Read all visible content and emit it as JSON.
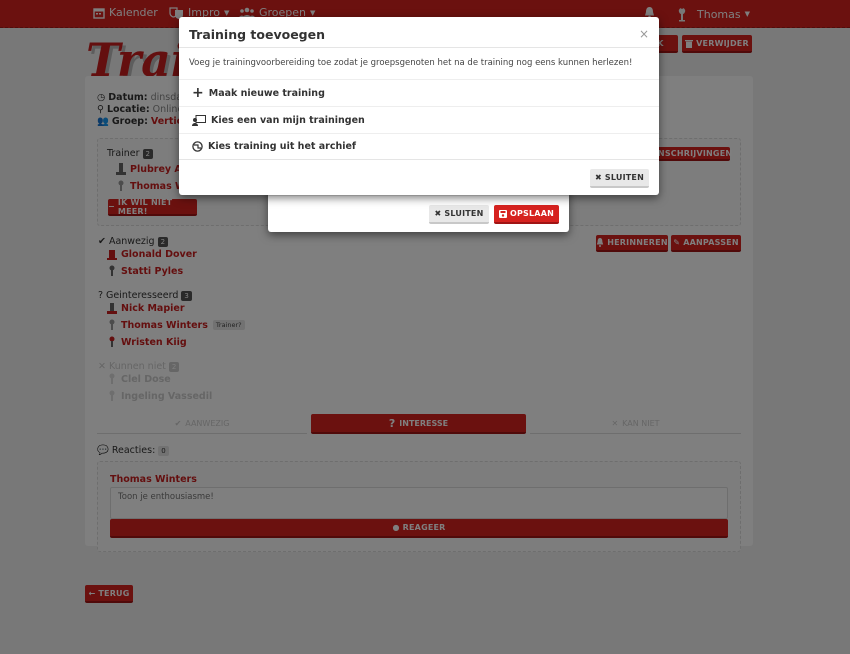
{
  "navbar": {
    "items": [
      {
        "label": "Kalender",
        "icon": "calendar-icon"
      },
      {
        "label": "Impro",
        "icon": "masks-icon",
        "dropdown": true
      },
      {
        "label": "Groepen",
        "icon": "users-icon",
        "dropdown": true
      }
    ],
    "user": {
      "label": "Thomas",
      "dropdown": true
    },
    "bell_icon": "bell-icon"
  },
  "page": {
    "title": "Training",
    "actions": {
      "edit_label": "BEWERK",
      "delete_label": "VERWIJDER"
    },
    "meta": {
      "date_label": "Datum:",
      "date_value": "dinsdag",
      "location_label": "Locatie:",
      "location_value": "Online v",
      "group_label": "Groep:",
      "group_value": "Vertical"
    },
    "trainer": {
      "title": "Trainer",
      "count": "2",
      "people": [
        "Plubrey Aa",
        "Thomas W"
      ],
      "leave_label": "IK WIL NIET MEER!",
      "registrations_label": "INSCHRIJVINGEN"
    },
    "remind_label": "HERINNEREN",
    "edit_label": "AANPASSEN",
    "present": {
      "title": "Aanwezig",
      "count": "2",
      "people": [
        "Glonald Dover",
        "Statti Pyles"
      ]
    },
    "interested": {
      "title": "Geinteresseerd",
      "count": "3",
      "people": [
        "Nick Mapier",
        "Thomas Winters",
        "Wristen Kiig"
      ],
      "trainer_tag": "Trainer?"
    },
    "cannot": {
      "title": "Kunnen niet",
      "count": "2",
      "people": [
        "Clel Dose",
        "Ingeling Vassedil"
      ]
    },
    "tabs": [
      {
        "label": "AANWEZIG",
        "active": false
      },
      {
        "label": "INTERESSE",
        "active": true
      },
      {
        "label": "KAN NIET",
        "active": false
      }
    ],
    "reactions": {
      "label": "Reacties:",
      "count": "0"
    },
    "comment": {
      "author": "Thomas Winters",
      "placeholder": "Toon je enthousiasme!",
      "submit_label": "REAGEER"
    },
    "back_label": "TERUG"
  },
  "behind_modal": {
    "close_label": "SLUITEN",
    "save_label": "OPSLAAN"
  },
  "modal": {
    "title": "Training toevoegen",
    "close_symbol": "×",
    "description": "Voeg je trainingvoorbereiding toe zodat je groepsgenoten het na de training nog eens kunnen herlezen!",
    "options": [
      {
        "label": "Maak nieuwe training",
        "icon": "plus-icon"
      },
      {
        "label": "Kies een van mijn trainingen",
        "icon": "chalkboard-teacher-icon"
      },
      {
        "label": "Kies training uit het archief",
        "icon": "archive-globe-icon"
      }
    ],
    "close_label": "SLUITEN"
  },
  "colors": {
    "brand": "#d6221f",
    "brand_dark": "#a01414"
  }
}
